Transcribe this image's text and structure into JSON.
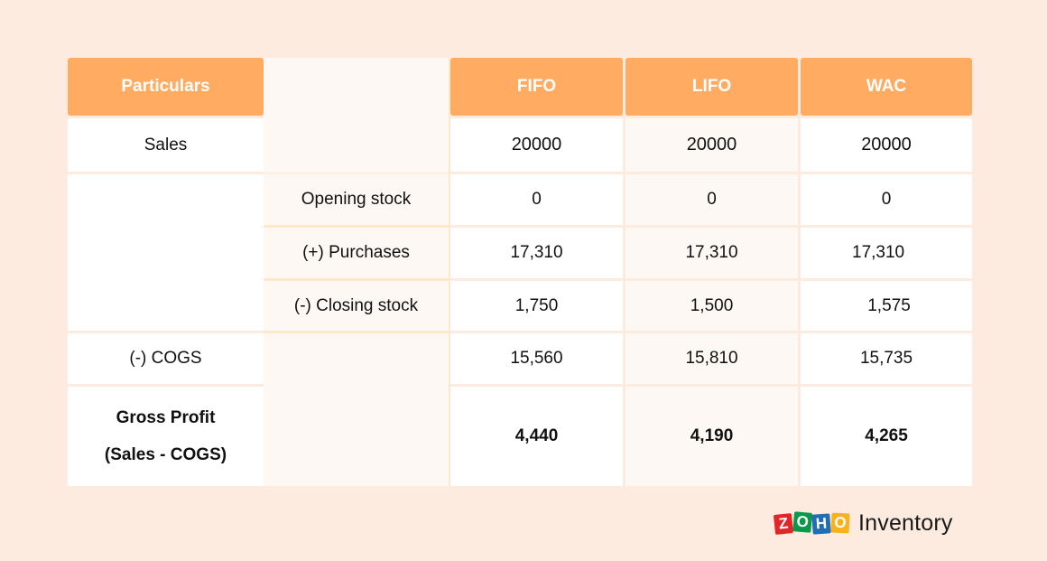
{
  "table": {
    "headers": {
      "particulars": "Particulars",
      "sub": "",
      "fifo": "FIFO",
      "lifo": "LIFO",
      "wac": "WAC"
    },
    "rows": [
      {
        "label": "Sales",
        "sub": "",
        "fifo": "20000",
        "lifo": "20000",
        "wac": "20000"
      },
      {
        "label": "",
        "sub": "Opening stock",
        "fifo": "0",
        "lifo": "0",
        "wac": "0"
      },
      {
        "label": "",
        "sub": "(+) Purchases",
        "fifo": "17,310",
        "lifo": "17,310",
        "wac": "17,310"
      },
      {
        "label": "",
        "sub": "(-) Closing stock",
        "fifo": "1,750",
        "lifo": "1,500",
        "wac": "1,575"
      },
      {
        "label": "(-) COGS",
        "sub": "",
        "fifo": "15,560",
        "lifo": "15,810",
        "wac": "15,735"
      },
      {
        "label_line1": "Gross Profit",
        "label_line2": "(Sales - COGS)",
        "sub": "",
        "fifo": "4,440",
        "lifo": "4,190",
        "wac": "4,265"
      }
    ]
  },
  "logo": {
    "letters": [
      "Z",
      "O",
      "H",
      "O"
    ],
    "product": "Inventory"
  },
  "colors": {
    "background": "#fdebdf",
    "header": "#ffab62",
    "grid_line": "#fde9c9",
    "tint_cell": "#fdf8f4"
  }
}
